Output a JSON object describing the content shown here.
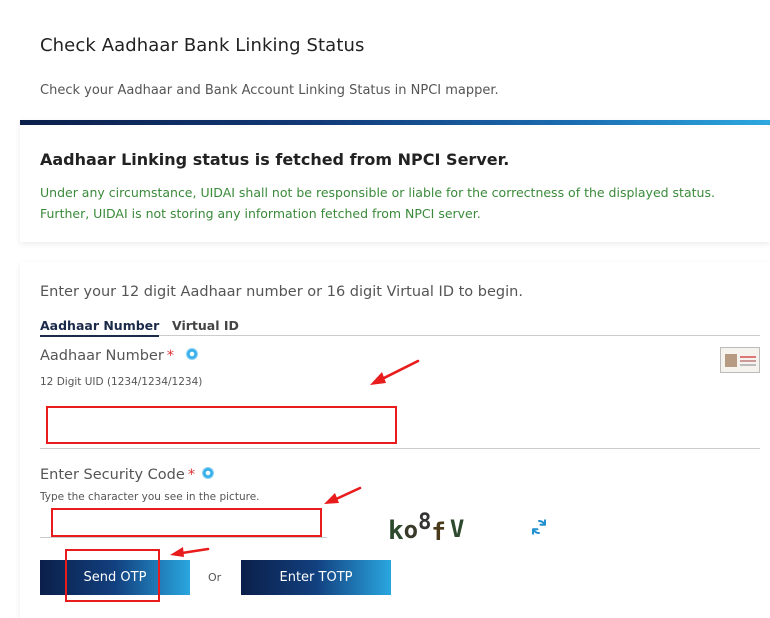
{
  "header": {
    "title": "Check Aadhaar Bank Linking Status",
    "subtitle": "Check your Aadhaar and Bank Account Linking Status in NPCI mapper."
  },
  "notice": {
    "title": "Aadhaar Linking status is fetched from NPCI Server.",
    "line1": "Under any circumstance, UIDAI shall not be responsible or liable for the correctness of the displayed status.",
    "line2": "Further, UIDAI is not storing any information fetched from NPCI server."
  },
  "form": {
    "intro": "Enter your 12 digit Aadhaar number or 16 digit Virtual ID to begin.",
    "tabs": [
      {
        "label": "Aadhaar Number",
        "active": true
      },
      {
        "label": "Virtual ID",
        "active": false
      }
    ],
    "aadhaar": {
      "label": "Aadhaar Number",
      "required_mark": "*",
      "hint": "12 Digit UID (1234/1234/1234)",
      "value": "",
      "placeholder": ""
    },
    "security": {
      "label": "Enter Security Code",
      "required_mark": "*",
      "hint": "Type the character you see in the picture.",
      "value": "",
      "placeholder": ""
    },
    "captcha": {
      "chars": [
        "k",
        "o",
        "8",
        "f",
        "V"
      ]
    },
    "buttons": {
      "send_otp": "Send OTP",
      "or": "Or",
      "enter_totp": "Enter TOTP"
    }
  },
  "colors": {
    "annotation_red": "#e81c1c",
    "notice_green": "#3a8a3a",
    "brand_navy": "#0b1f4a",
    "brand_cyan": "#2aa6df"
  },
  "icons": {
    "info": "info-icon",
    "refresh": "refresh-icon",
    "aadhaar_card": "aadhaar-card-icon"
  }
}
